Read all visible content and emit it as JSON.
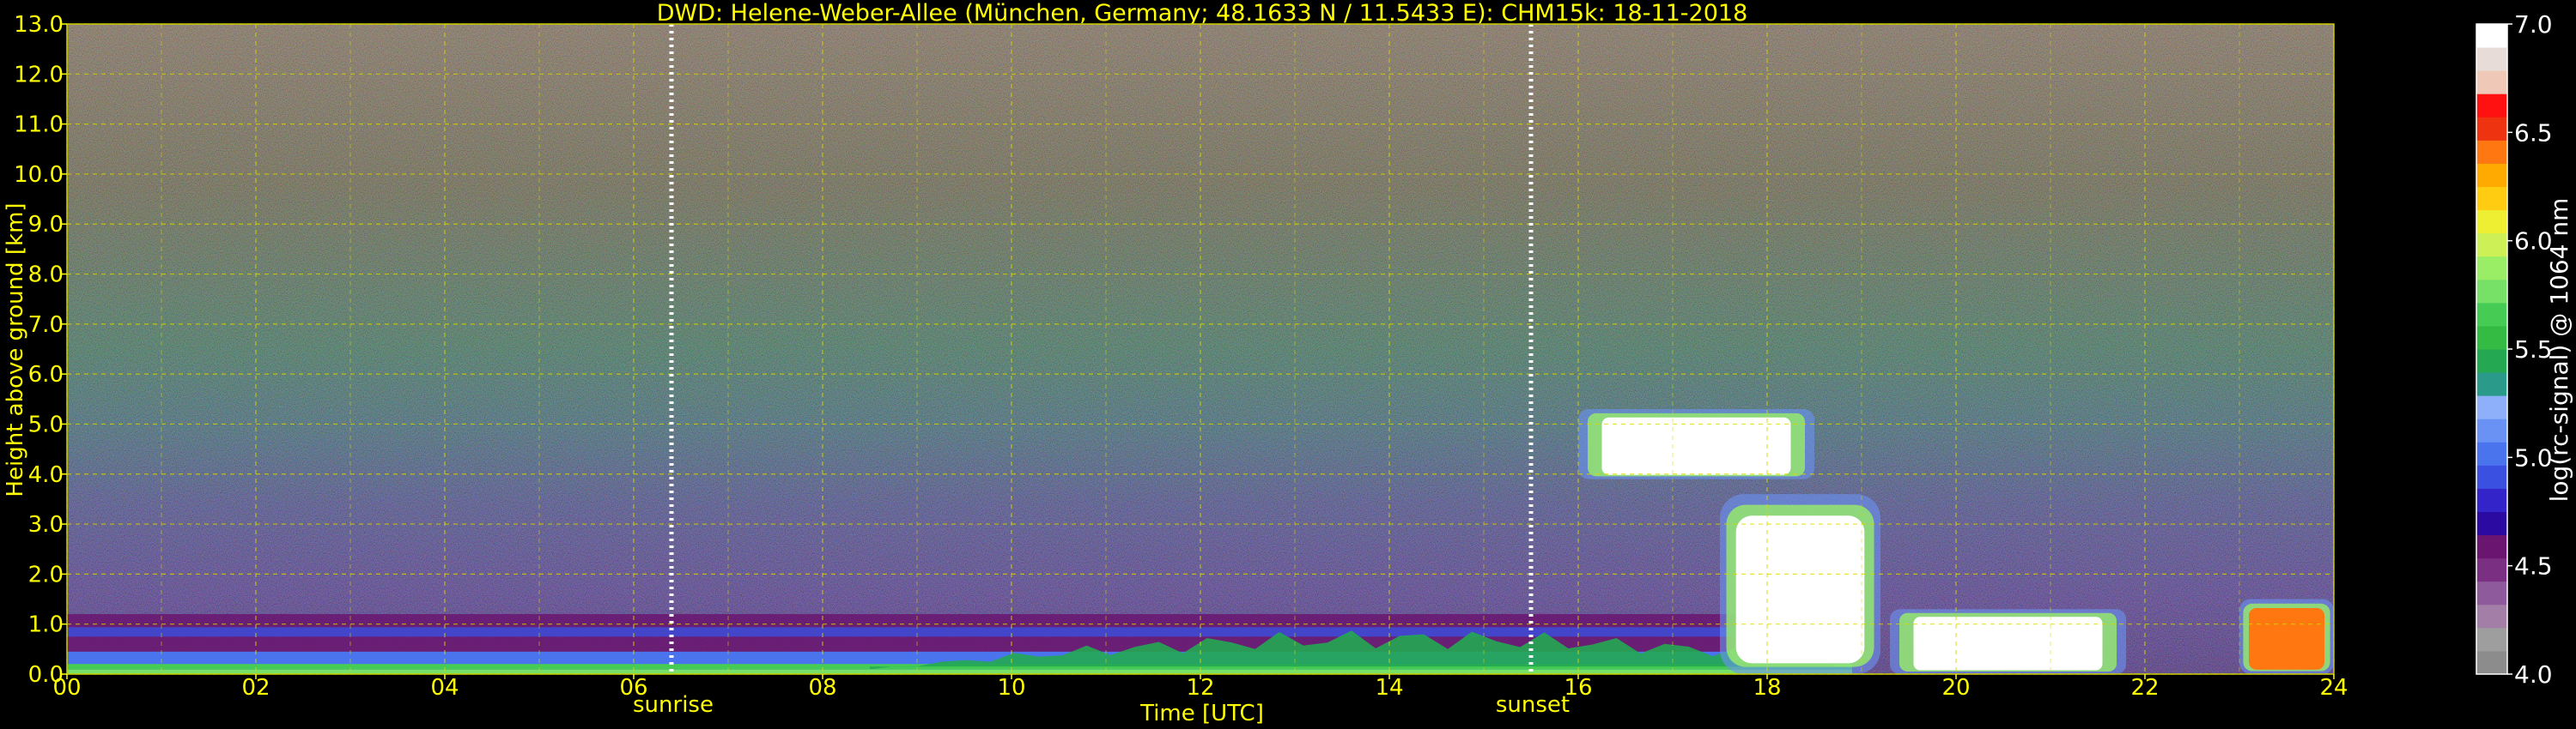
{
  "chart_data": {
    "type": "heatmap",
    "title": "DWD: Helene-Weber-Allee (München, Germany; 48.1633 N / 11.5433 E):    CHM15k: 18-11-2018",
    "xlabel": "Time [UTC]",
    "ylabel": "Height above ground [km]",
    "xlim": [
      0,
      24
    ],
    "ylim": [
      0,
      13
    ],
    "x_ticks": [
      "00",
      "02",
      "04",
      "06",
      "08",
      "10",
      "12",
      "14",
      "16",
      "18",
      "20",
      "22",
      "24"
    ],
    "y_ticks": [
      "0.0",
      "1.0",
      "2.0",
      "3.0",
      "4.0",
      "5.0",
      "6.0",
      "7.0",
      "8.0",
      "9.0",
      "10.0",
      "11.0",
      "12.0",
      "13.0"
    ],
    "grid": true,
    "markers": [
      {
        "label": "sunrise",
        "time": 6.4
      },
      {
        "label": "sunset",
        "time": 15.5
      }
    ],
    "colorbar": {
      "label": "log(rc-signal) @ 1064 nm",
      "range": [
        4.0,
        7.0
      ],
      "ticks": [
        "4.0",
        "4.5",
        "5.0",
        "5.5",
        "6.0",
        "6.5",
        "7.0"
      ],
      "colors": [
        "#8c8c8c",
        "#9e9e9e",
        "#a37fa8",
        "#8f5a9b",
        "#7a2f82",
        "#6a1570",
        "#2a0aa0",
        "#3224c8",
        "#3a50e0",
        "#4a74ee",
        "#6a92f4",
        "#8eb0fa",
        "#2a9a8a",
        "#24a852",
        "#33bb44",
        "#46cc55",
        "#77e066",
        "#99ee66",
        "#ccf055",
        "#eeee33",
        "#ffcc11",
        "#ffaa00",
        "#ff7711",
        "#ee3311",
        "#ff1111",
        "#f0c8b8",
        "#e8dcd8",
        "#ffffff"
      ]
    },
    "features": [
      {
        "name": "surface-layer",
        "time": [
          0,
          18.9
        ],
        "height_km": [
          0.0,
          0.45
        ],
        "level": 5.4
      },
      {
        "name": "residual-layer",
        "time": [
          0,
          18.9
        ],
        "height_km": [
          0.45,
          1.2
        ],
        "level": 4.6
      },
      {
        "name": "growing-mixed-layer",
        "time": [
          8.5,
          18.7
        ],
        "height_km": [
          0.1,
          0.9
        ],
        "level": 5.5
      },
      {
        "name": "high-cloud",
        "time": [
          16.0,
          18.5
        ],
        "height_km": [
          3.9,
          5.3
        ],
        "level": 7.0
      },
      {
        "name": "low-cloud-1",
        "time": [
          17.5,
          19.2
        ],
        "height_km": [
          0.0,
          3.6
        ],
        "level": 7.0
      },
      {
        "name": "low-cloud-2",
        "time": [
          19.3,
          21.8
        ],
        "height_km": [
          0.0,
          1.3
        ],
        "level": 7.0
      },
      {
        "name": "low-cloud-3",
        "time": [
          23.0,
          24.0
        ],
        "height_km": [
          0.0,
          1.5
        ],
        "level": 6.5
      }
    ]
  }
}
